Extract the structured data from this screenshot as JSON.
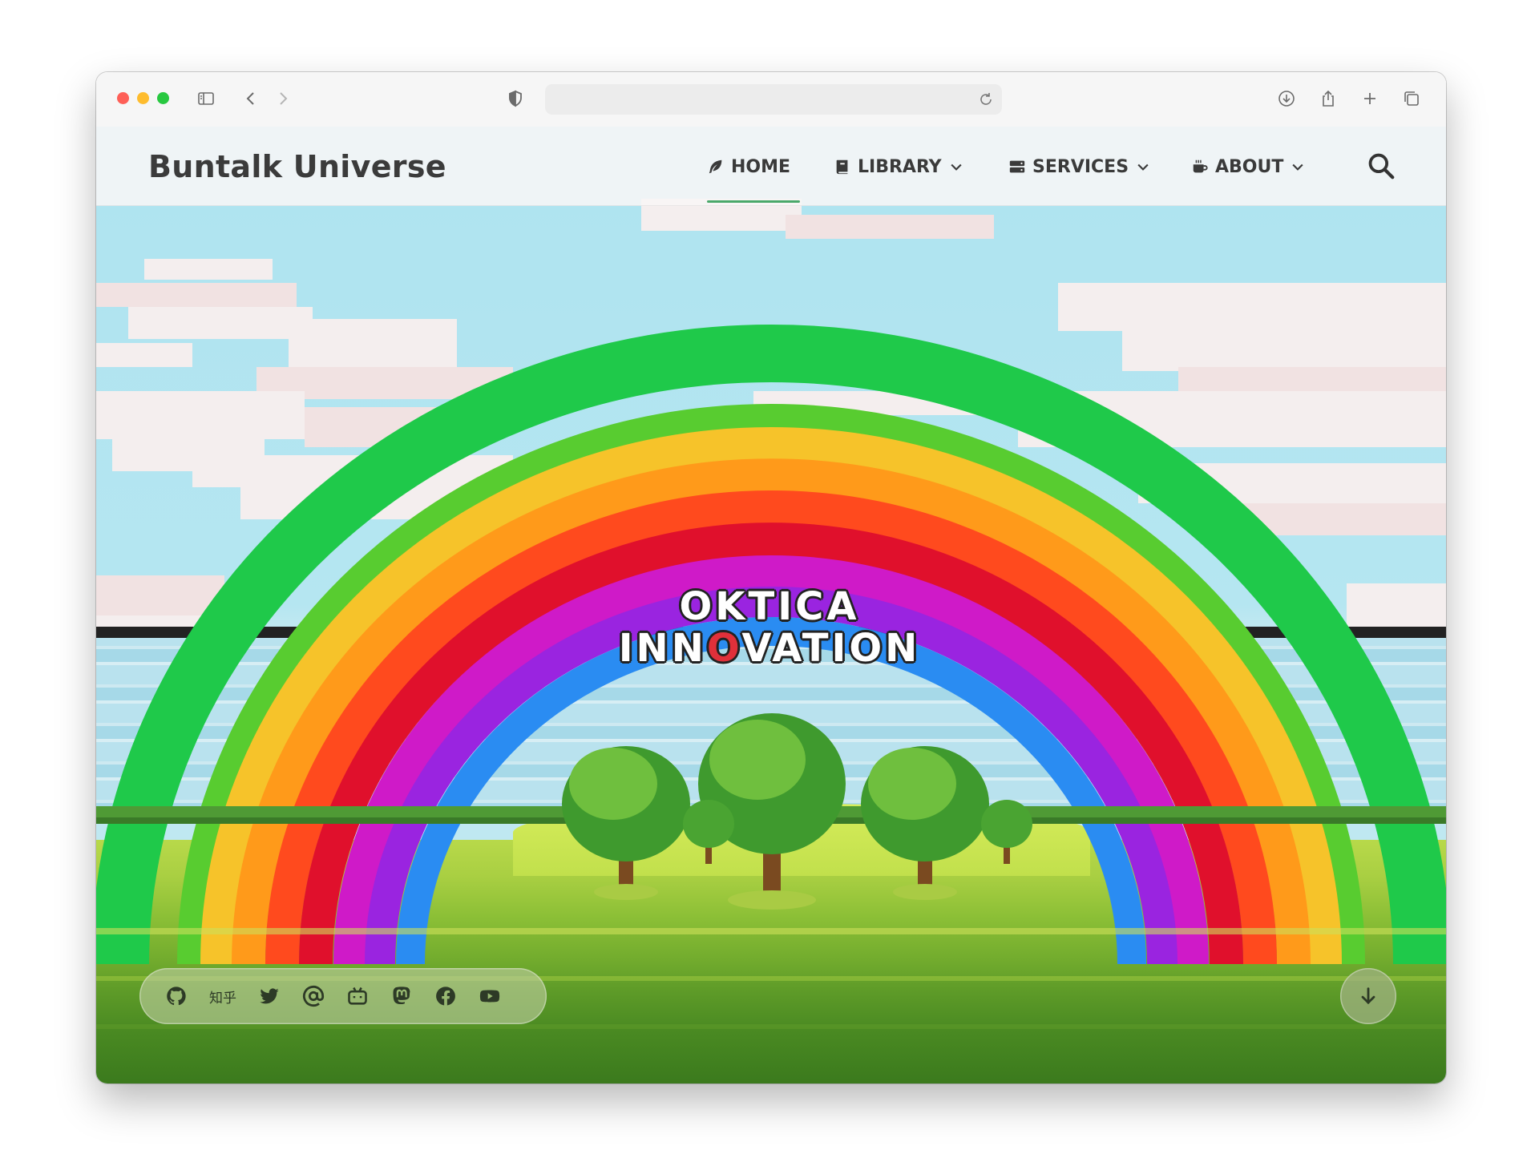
{
  "browser": {
    "url": "",
    "icons": {
      "sidebar": "sidebar-icon",
      "back": "chevron-left-icon",
      "forward": "chevron-right-icon",
      "privacy": "shield-icon",
      "reload": "reload-icon",
      "download": "download-icon",
      "share": "share-icon",
      "new_tab": "plus-icon",
      "tabs": "tabs-overview-icon"
    }
  },
  "site": {
    "brand": "Buntalk Universe",
    "nav": [
      {
        "label": "HOME",
        "icon": "feather-icon",
        "active": true
      },
      {
        "label": "LIBRARY",
        "icon": "book-icon",
        "dropdown": true
      },
      {
        "label": "SERVICES",
        "icon": "server-icon",
        "dropdown": true
      },
      {
        "label": "ABOUT",
        "icon": "coffee-icon",
        "dropdown": true
      }
    ],
    "accent": "#4aa86a"
  },
  "hero": {
    "logo_line1": "OKTICA",
    "logo_line2_a": "INN",
    "logo_line2_o": "O",
    "logo_line2_b": "VATION"
  },
  "social": {
    "items": [
      "github-icon",
      "zhihu",
      "twitter-icon",
      "at-sign-icon",
      "bilibili-icon",
      "mastodon-icon",
      "facebook-icon",
      "youtube-icon"
    ],
    "zhihu_label": "知乎"
  }
}
